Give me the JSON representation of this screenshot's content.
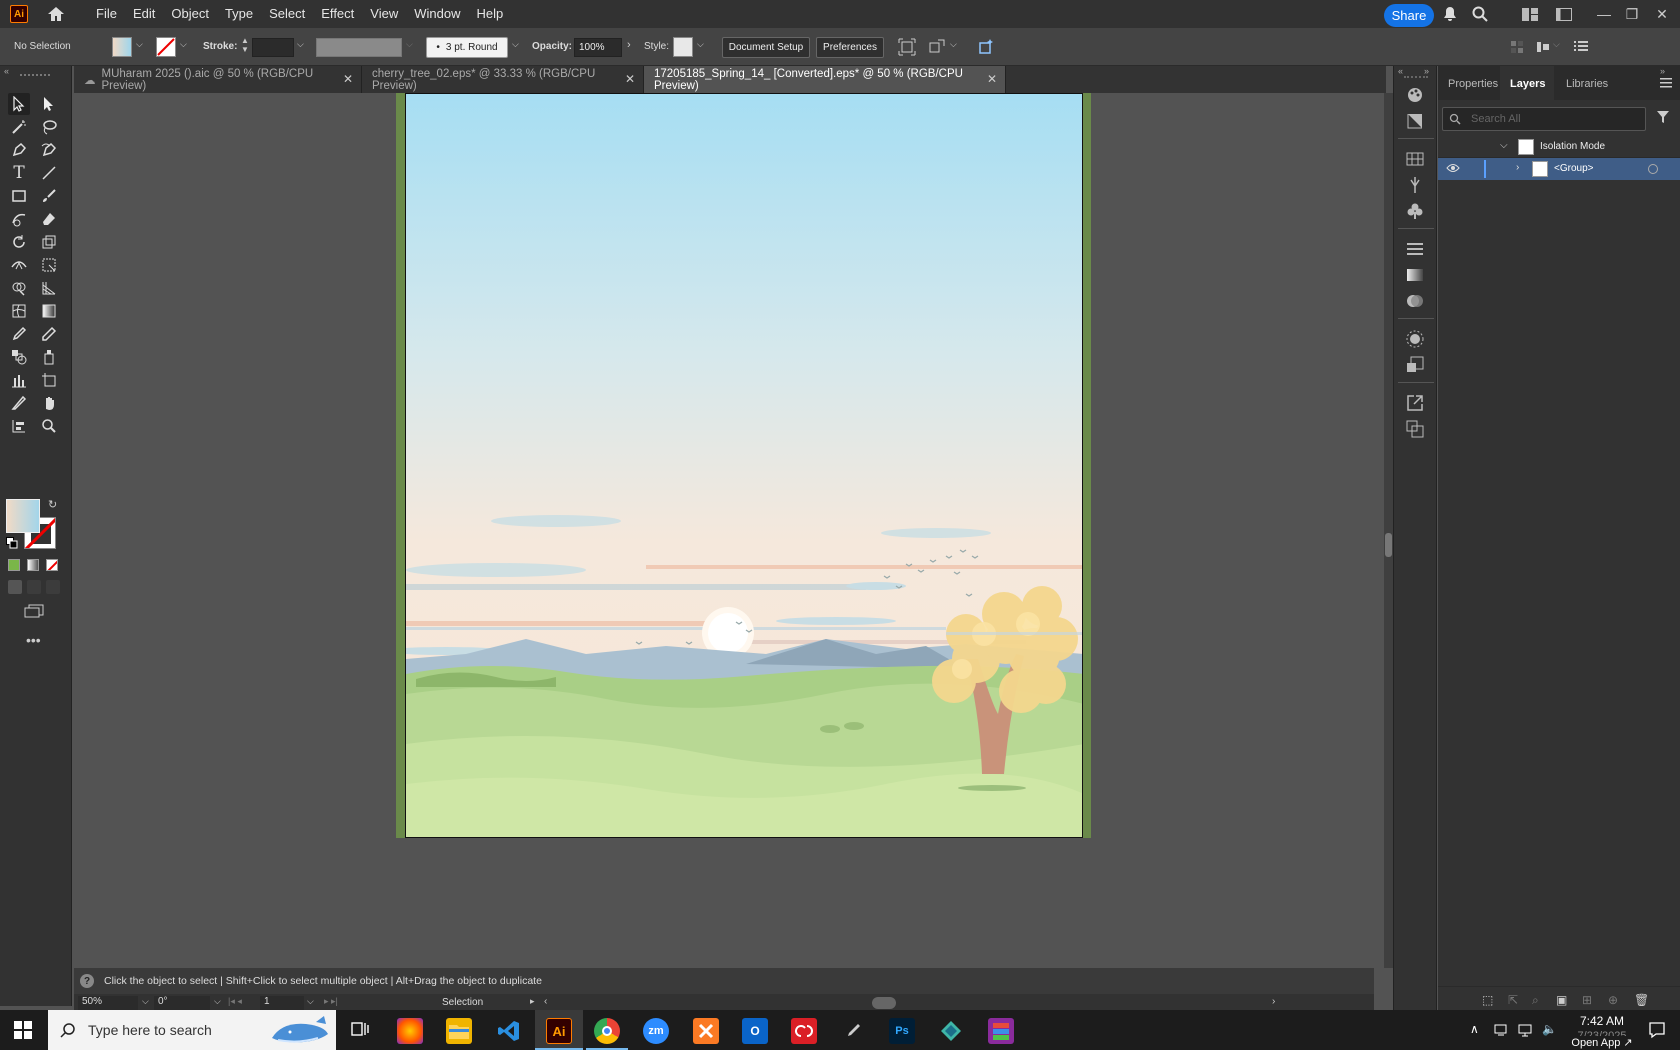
{
  "app": {
    "logo": "Ai",
    "share_label": "Share"
  },
  "menu": [
    "File",
    "Edit",
    "Object",
    "Type",
    "Select",
    "Effect",
    "View",
    "Window",
    "Help"
  ],
  "control": {
    "selection": "No Selection",
    "stroke_label": "Stroke:",
    "brush": "3 pt. Round",
    "opacity_label": "Opacity:",
    "opacity_value": "100%",
    "style_label": "Style:",
    "document_setup": "Document Setup",
    "preferences": "Preferences"
  },
  "tabs": [
    {
      "label": "MUharam 2025 ().aic @ 50 % (RGB/CPU Preview)"
    },
    {
      "label": "cherry_tree_02.eps* @ 33.33 % (RGB/CPU Preview)"
    },
    {
      "label": "17205185_Spring_14_ [Converted].eps* @ 50 % (RGB/CPU Preview)"
    }
  ],
  "status": {
    "help_text": "Click the object to select  |  Shift+Click to select multiple object  |  Alt+Drag the object to duplicate",
    "zoom": "50%",
    "rotation": "0°",
    "artboard_num": "1",
    "tool_name": "Selection"
  },
  "panel": {
    "tabs": [
      "Properties",
      "Layers",
      "Libraries"
    ],
    "active_tab": "Layers",
    "search_placeholder": "Search All",
    "isolation_label": "Isolation Mode",
    "group_label": "<Group>"
  },
  "taskbar": {
    "search_placeholder": "Type here to search",
    "time": "7:42 AM",
    "date": "7/23/2025",
    "open_app": "Open App"
  },
  "colors": {
    "accent": "#1473e6",
    "layer_highlight": "#3f5d87"
  }
}
